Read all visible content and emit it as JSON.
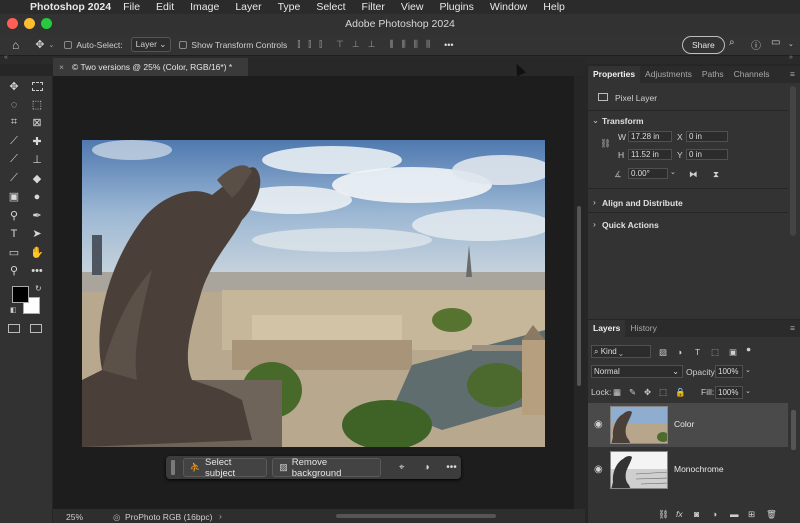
{
  "menubar": {
    "app_name": "Photoshop 2024",
    "items": [
      "File",
      "Edit",
      "Image",
      "Layer",
      "Type",
      "Select",
      "Filter",
      "View",
      "Plugins",
      "Window",
      "Help"
    ]
  },
  "window": {
    "title": "Adobe Photoshop 2024"
  },
  "options_bar": {
    "auto_select_label": "Auto-Select:",
    "auto_select_value": "Layer",
    "show_transform_label": "Show Transform Controls",
    "share_label": "Share"
  },
  "document": {
    "tab_title": "© Two versions @ 25% (Color, RGB/16*) *",
    "zoom": "25%",
    "profile": "ProPhoto RGB (16bpc)"
  },
  "context_bar": {
    "select_subject": "Select subject",
    "remove_background": "Remove background"
  },
  "properties": {
    "tabs": [
      "Properties",
      "Adjustments",
      "Paths",
      "Channels"
    ],
    "active_tab": "Properties",
    "layer_type": "Pixel Layer",
    "transform_header": "Transform",
    "w_label": "W",
    "w_value": "17.28 in",
    "h_label": "H",
    "h_value": "11.52 in",
    "x_label": "X",
    "x_value": "0 in",
    "y_label": "Y",
    "y_value": "0 in",
    "angle_value": "0.00°",
    "align_header": "Align and Distribute",
    "quick_actions_header": "Quick Actions"
  },
  "layers_panel": {
    "tabs": [
      "Layers",
      "History"
    ],
    "active_tab": "Layers",
    "filter_kind": "Kind",
    "blend_mode": "Normal",
    "opacity_label": "Opacity:",
    "opacity_value": "100%",
    "lock_label": "Lock:",
    "fill_label": "Fill:",
    "fill_value": "100%",
    "layers": [
      {
        "name": "Color",
        "visible": true,
        "selected": true
      },
      {
        "name": "Monochrome",
        "visible": true,
        "selected": false
      }
    ],
    "footer_fx": "fx"
  },
  "colors": {
    "traffic_red": "#ff5f57",
    "traffic_yellow": "#febc2e",
    "traffic_green": "#28c840",
    "panel_bg": "#333333",
    "selected_layer": "#4a4a4a"
  }
}
